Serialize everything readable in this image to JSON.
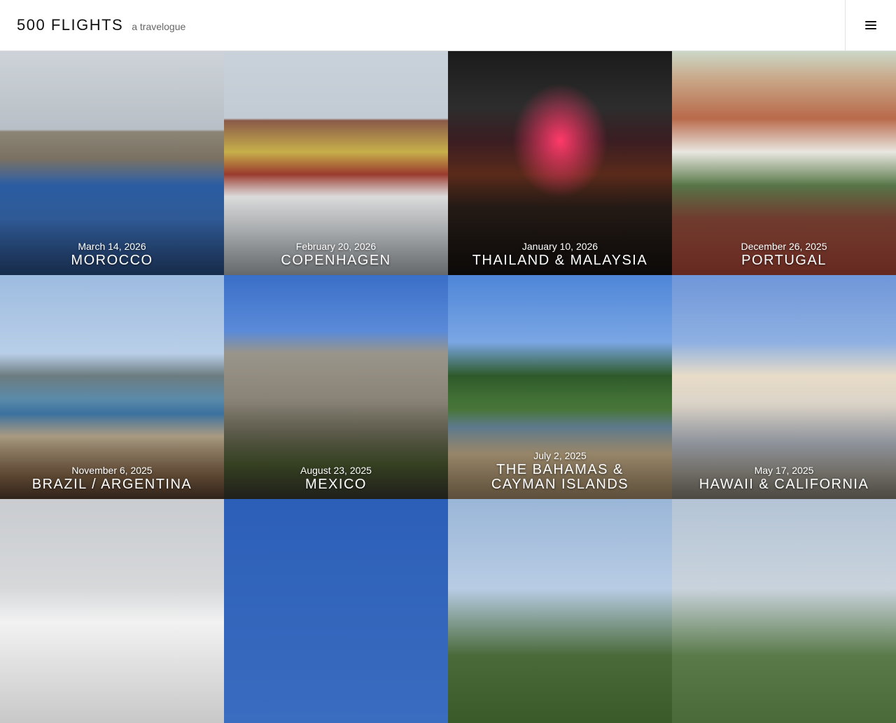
{
  "header": {
    "site_title": "500 FLIGHTS",
    "tagline": "a travelogue"
  },
  "icons": {
    "menu": "hamburger-menu-icon"
  },
  "posts": [
    {
      "date": "March 14, 2026",
      "title": "MOROCCO"
    },
    {
      "date": "February 20, 2026",
      "title": "COPENHAGEN"
    },
    {
      "date": "January 10, 2026",
      "title": "THAILAND & MALAYSIA"
    },
    {
      "date": "December 26, 2025",
      "title": "PORTUGAL"
    },
    {
      "date": "November 6, 2025",
      "title": "BRAZIL / ARGENTINA"
    },
    {
      "date": "August 23, 2025",
      "title": "MEXICO"
    },
    {
      "date": "July 2, 2025",
      "title": "THE BAHAMAS & CAYMAN ISLANDS"
    },
    {
      "date": "May 17, 2025",
      "title": "HAWAII & CALIFORNIA"
    }
  ]
}
